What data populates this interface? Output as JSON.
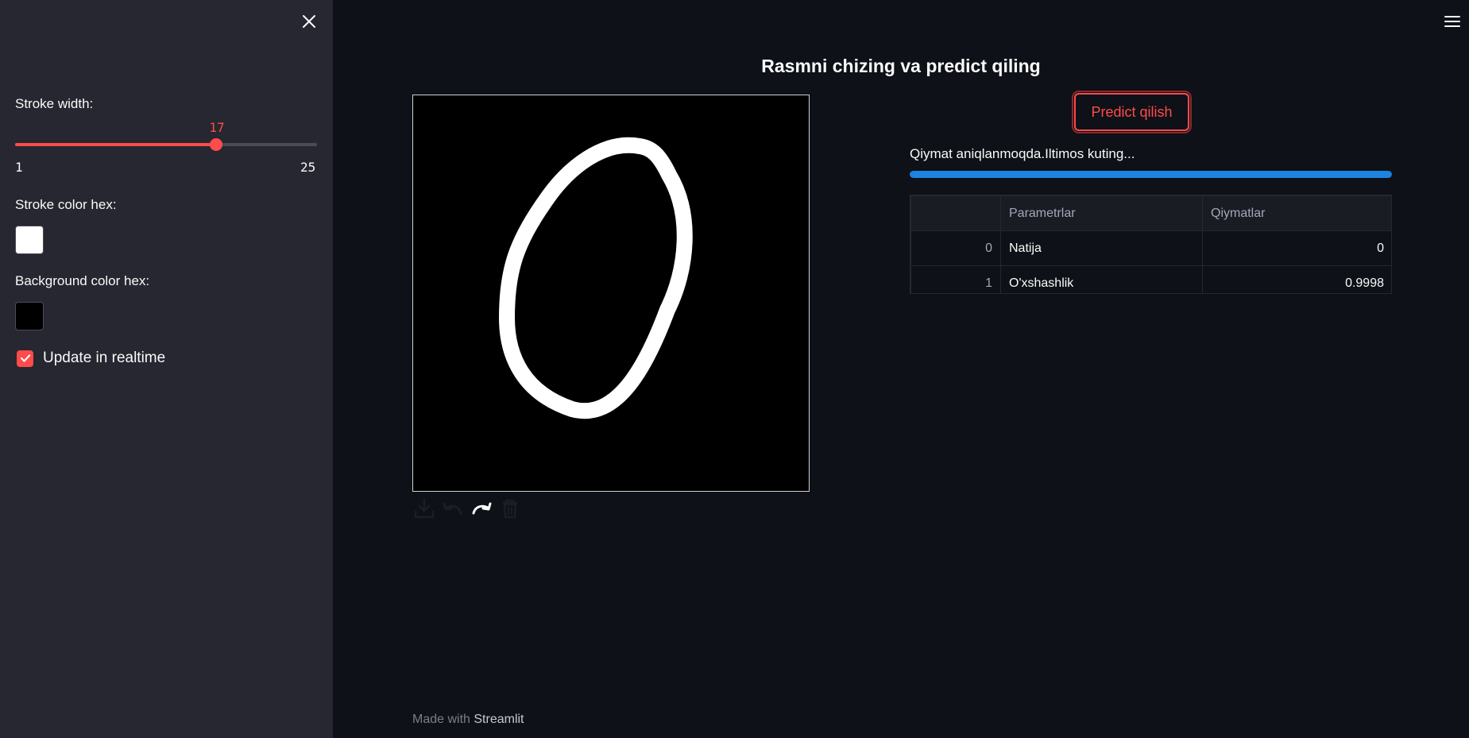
{
  "sidebar": {
    "stroke_width": {
      "label": "Stroke width:",
      "value": 17,
      "value_text": "17",
      "min": 1,
      "min_text": "1",
      "max": 25,
      "max_text": "25"
    },
    "stroke_color": {
      "label": "Stroke color hex:",
      "color": "#ffffff"
    },
    "background_color": {
      "label": "Background color hex:",
      "color": "#000000"
    },
    "realtime": {
      "label": "Update in realtime",
      "checked": true
    }
  },
  "main": {
    "title": "Rasmni chizing va predict qiling",
    "predict_button": "Predict qilish",
    "status": "Qiymat aniqlanmoqda.Iltimos kuting...",
    "progress": 1.0,
    "table": {
      "headers": [
        "",
        "Parametrlar",
        "Qiymatlar"
      ],
      "rows": [
        {
          "index": "0",
          "param": "Natija",
          "value": "0"
        },
        {
          "index": "1",
          "param": "O'xshashlik",
          "value": "0.9998"
        }
      ]
    },
    "footer": {
      "prefix": "Made with ",
      "brand": "Streamlit"
    }
  },
  "icons": {
    "close": "close-icon",
    "menu": "hamburger-menu-icon",
    "download": "download-icon",
    "undo": "undo-icon",
    "redo": "redo-icon",
    "delete": "trash-icon"
  },
  "colors": {
    "accent": "#ff4b4b",
    "progress": "#1c83e1",
    "sidebar_bg": "#262730",
    "main_bg": "#0e1117"
  }
}
